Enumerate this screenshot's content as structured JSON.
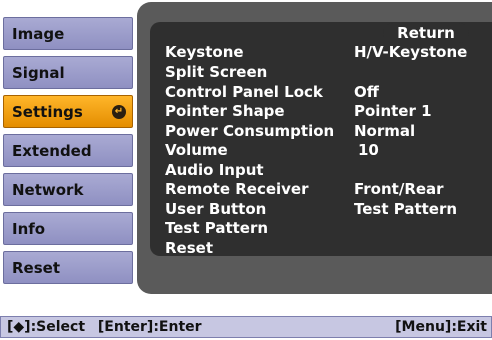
{
  "sidebar": {
    "items": [
      {
        "label": "Image",
        "active": false
      },
      {
        "label": "Signal",
        "active": false
      },
      {
        "label": "Settings",
        "active": true
      },
      {
        "label": "Extended",
        "active": false
      },
      {
        "label": "Network",
        "active": false
      },
      {
        "label": "Info",
        "active": false
      },
      {
        "label": "Reset",
        "active": false
      }
    ],
    "active_icon": "enter-icon"
  },
  "panel": {
    "return_label": "Return",
    "rows": [
      {
        "label": "Keystone",
        "value": "H/V-Keystone"
      },
      {
        "label": "Split Screen",
        "value": ""
      },
      {
        "label": "Control Panel Lock",
        "value": "Off"
      },
      {
        "label": "Pointer Shape",
        "value": "Pointer 1"
      },
      {
        "label": "Power Consumption",
        "value": "Normal"
      },
      {
        "label": "Volume",
        "value": "10"
      },
      {
        "label": "Audio Input",
        "value": ""
      },
      {
        "label": "Remote Receiver",
        "value": "Front/Rear"
      },
      {
        "label": "User Button",
        "value": "Test Pattern"
      },
      {
        "label": "Test Pattern",
        "value": ""
      },
      {
        "label": "Reset",
        "value": ""
      }
    ]
  },
  "footer": {
    "select_hint": "[◆]:Select",
    "enter_hint": "[Enter]:Enter",
    "exit_hint": "[Menu]:Exit"
  },
  "colors": {
    "active_tab": "#ffb62a",
    "inactive_tab": "#a9aad3",
    "panel_bg": "#5a5a5a",
    "panel_inner_bg": "#2f2f2f"
  }
}
